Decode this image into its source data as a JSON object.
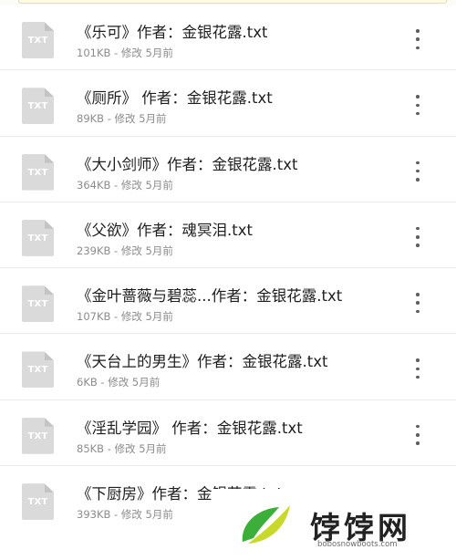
{
  "files": [
    {
      "name": "《乐可》作者：金银花露.txt",
      "size": "101KB",
      "modified": "修改 5月前",
      "type": "TXT"
    },
    {
      "name": "《厕所》 作者：金银花露.txt",
      "size": "89KB",
      "modified": "修改 5月前",
      "type": "TXT"
    },
    {
      "name": "《大小剑师》作者：金银花露.txt",
      "size": "364KB",
      "modified": "修改 5月前",
      "type": "TXT"
    },
    {
      "name": "《父欲》作者：魂冥泪.txt",
      "size": "239KB",
      "modified": "修改 5月前",
      "type": "TXT"
    },
    {
      "name": "《金叶蔷薇与碧蕊...作者：金银花露.txt",
      "size": "107KB",
      "modified": "修改 5月前",
      "type": "TXT"
    },
    {
      "name": "《天台上的男生》作者：金银花露.txt",
      "size": "6KB",
      "modified": "修改 5月前",
      "type": "TXT"
    },
    {
      "name": "《淫乱学园》 作者：金银花露.txt",
      "size": "85KB",
      "modified": "修改 5月前",
      "type": "TXT"
    },
    {
      "name": "《下厨房》作者：金银花露.txt",
      "size": "393KB",
      "modified": "修改 5月前",
      "type": "TXT"
    }
  ],
  "meta_separator": " - ",
  "watermark": {
    "brand": "饽饽网",
    "url": "bobosnowboots.com"
  },
  "colors": {
    "icon_bg": "#dadada",
    "text": "#1e1e1e",
    "meta": "#8c8c8c",
    "logo_green": "#3cae3a",
    "logo_yellow": "#c9d92c"
  }
}
